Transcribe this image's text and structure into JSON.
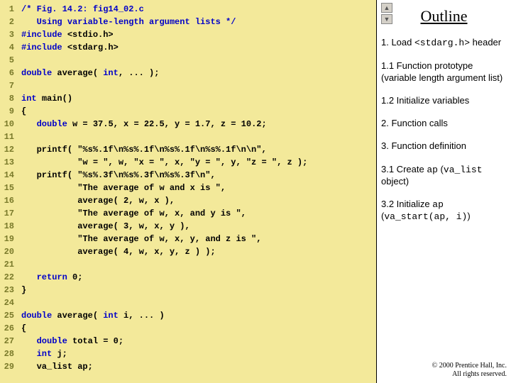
{
  "code": {
    "lines": [
      {
        "n": "1",
        "pre": "",
        "seg": [
          {
            "t": "/* Fig. 14.2: fig14_02.c",
            "c": "cm"
          }
        ]
      },
      {
        "n": "2",
        "pre": "   ",
        "seg": [
          {
            "t": "Using variable-length argument lists */",
            "c": "cm"
          }
        ]
      },
      {
        "n": "3",
        "pre": "",
        "seg": [
          {
            "t": "#include ",
            "c": "kw"
          },
          {
            "t": "<stdio.h>",
            "c": ""
          }
        ]
      },
      {
        "n": "4",
        "pre": "",
        "seg": [
          {
            "t": "#include ",
            "c": "kw"
          },
          {
            "t": "<stdarg.h>",
            "c": ""
          }
        ]
      },
      {
        "n": "5",
        "pre": "",
        "seg": []
      },
      {
        "n": "6",
        "pre": "",
        "seg": [
          {
            "t": "double ",
            "c": "kw"
          },
          {
            "t": "average( ",
            "c": ""
          },
          {
            "t": "int",
            "c": "kw"
          },
          {
            "t": ", ... );",
            "c": ""
          }
        ]
      },
      {
        "n": "7",
        "pre": "",
        "seg": []
      },
      {
        "n": "8",
        "pre": "",
        "seg": [
          {
            "t": "int ",
            "c": "kw"
          },
          {
            "t": "main()",
            "c": ""
          }
        ]
      },
      {
        "n": "9",
        "pre": "",
        "seg": [
          {
            "t": "{",
            "c": ""
          }
        ]
      },
      {
        "n": "10",
        "pre": "   ",
        "seg": [
          {
            "t": "double ",
            "c": "kw"
          },
          {
            "t": "w = 37.5, x = 22.5, y = 1.7, z = 10.2;",
            "c": ""
          }
        ]
      },
      {
        "n": "11",
        "pre": "",
        "seg": []
      },
      {
        "n": "12",
        "pre": "   ",
        "seg": [
          {
            "t": "printf( \"%s%.1f\\n%s%.1f\\n%s%.1f\\n%s%.1f\\n\\n\",",
            "c": ""
          }
        ]
      },
      {
        "n": "13",
        "pre": "           ",
        "seg": [
          {
            "t": "\"w = \", w, \"x = \", x, \"y = \", y, \"z = \", z );",
            "c": ""
          }
        ]
      },
      {
        "n": "14",
        "pre": "   ",
        "seg": [
          {
            "t": "printf( \"%s%.3f\\n%s%.3f\\n%s%.3f\\n\",",
            "c": ""
          }
        ]
      },
      {
        "n": "15",
        "pre": "           ",
        "seg": [
          {
            "t": "\"The average of w and x is \",",
            "c": ""
          }
        ]
      },
      {
        "n": "16",
        "pre": "           ",
        "seg": [
          {
            "t": "average( 2, w, x ),",
            "c": ""
          }
        ]
      },
      {
        "n": "17",
        "pre": "           ",
        "seg": [
          {
            "t": "\"The average of w, x, and y is \",",
            "c": ""
          }
        ]
      },
      {
        "n": "18",
        "pre": "           ",
        "seg": [
          {
            "t": "average( 3, w, x, y ),",
            "c": ""
          }
        ]
      },
      {
        "n": "19",
        "pre": "           ",
        "seg": [
          {
            "t": "\"The average of w, x, y, and z is \",",
            "c": ""
          }
        ]
      },
      {
        "n": "20",
        "pre": "           ",
        "seg": [
          {
            "t": "average( 4, w, x, y, z ) );",
            "c": ""
          }
        ]
      },
      {
        "n": "21",
        "pre": "",
        "seg": []
      },
      {
        "n": "22",
        "pre": "   ",
        "seg": [
          {
            "t": "return ",
            "c": "kw"
          },
          {
            "t": "0;",
            "c": ""
          }
        ]
      },
      {
        "n": "23",
        "pre": "",
        "seg": [
          {
            "t": "}",
            "c": ""
          }
        ]
      },
      {
        "n": "24",
        "pre": "",
        "seg": []
      },
      {
        "n": "25",
        "pre": "",
        "seg": [
          {
            "t": "double ",
            "c": "kw"
          },
          {
            "t": "average( ",
            "c": ""
          },
          {
            "t": "int ",
            "c": "kw"
          },
          {
            "t": "i, ... )",
            "c": ""
          }
        ]
      },
      {
        "n": "26",
        "pre": "",
        "seg": [
          {
            "t": "{",
            "c": ""
          }
        ]
      },
      {
        "n": "27",
        "pre": "   ",
        "seg": [
          {
            "t": "double ",
            "c": "kw"
          },
          {
            "t": "total = 0;",
            "c": ""
          }
        ]
      },
      {
        "n": "28",
        "pre": "   ",
        "seg": [
          {
            "t": "int ",
            "c": "kw"
          },
          {
            "t": "j;",
            "c": ""
          }
        ]
      },
      {
        "n": "29",
        "pre": "   ",
        "seg": [
          {
            "t": "va_list ap;",
            "c": ""
          }
        ]
      }
    ]
  },
  "outline": {
    "heading": "Outline",
    "n1_a": "1. Load ",
    "n1_b": "<stdarg.h>",
    "n1_c": " header",
    "n2": "1.1 Function prototype (variable length argument list)",
    "n3": "1.2 Initialize variables",
    "n4": "2. Function calls",
    "n5": "3. Function definition",
    "n6_a": "3.1 Create ",
    "n6_b": "ap",
    "n6_c": " (",
    "n6_d": "va_list",
    "n6_e": " object)",
    "n7_a": "3.2 Initialize ",
    "n7_b": "ap",
    "n7_c": " (",
    "n7_d": "va_start(ap, i)",
    "n7_e": ")"
  },
  "nav": {
    "up": "▲",
    "down": "▼"
  },
  "copyright": {
    "line1": "© 2000 Prentice Hall, Inc.",
    "line2": "All rights reserved."
  }
}
